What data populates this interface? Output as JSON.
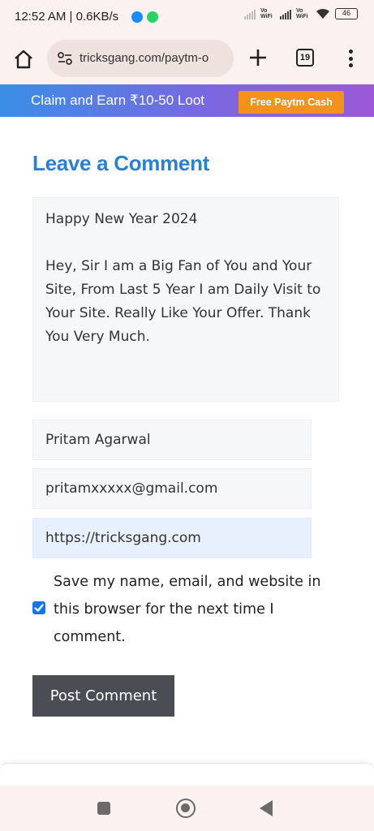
{
  "status_bar": {
    "time": "12:52 AM | 0.6KB/s",
    "vowifi_1": "Vo WiFi",
    "vowifi_2": "Vo WiFi",
    "battery": "46",
    "messenger_color": "#1a8cff",
    "whatsapp_color": "#25d366"
  },
  "browser": {
    "url": "tricksgang.com/paytm-o",
    "tab_count": "19",
    "icons": [
      "home-icon",
      "site-settings-icon",
      "new-tab-icon",
      "tab-switcher-icon",
      "more-menu-icon"
    ]
  },
  "banner": {
    "text": "Claim and Earn ₹10-50 Loot",
    "button_label": "Free Paytm Cash",
    "button_color": "#f5921e"
  },
  "comment_form": {
    "title": "Leave a Comment",
    "comment_text": "Happy New Year 2024\n\nHey, Sir I am a Big Fan of You and Your Site, From Last 5 Year I am Daily Visit to Your Site. Really Like Your Offer. Thank You Very Much.",
    "name_value": "Pritam Agarwal",
    "email_value": "pritamxxxxx@gmail.com",
    "website_value": "https://tricksgang.com",
    "consent_label": "Save my name, email, and website in this browser for the next time I comment.",
    "consent_checked": true,
    "submit_label": "Post Comment",
    "accent_color": "#2f7fd0"
  },
  "nav_bar": {
    "icons": [
      "recents-icon",
      "home-circle-icon",
      "back-icon"
    ]
  }
}
